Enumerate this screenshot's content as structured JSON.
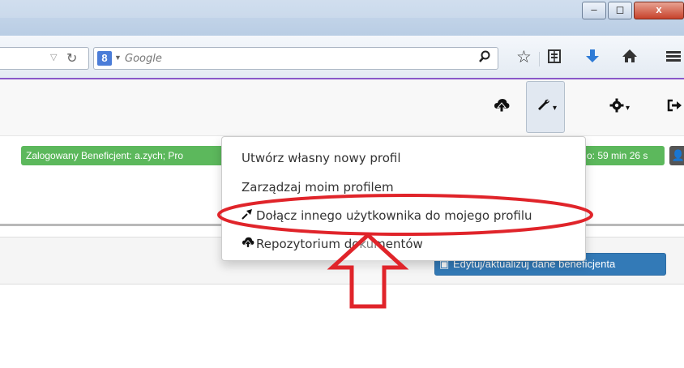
{
  "window": {
    "minimize_glyph": "–",
    "maximize_glyph": "◻",
    "close_glyph": "x"
  },
  "toolbar": {
    "url_dropmark_icon": "dropmarker-icon",
    "reload_icon": "reload-icon",
    "search_engine_badge": "8",
    "search_placeholder": "Google",
    "icons": [
      "search-icon",
      "star-icon",
      "reader-icon",
      "download-icon",
      "home-icon",
      "menu-icon"
    ]
  },
  "navbar": {
    "icons": [
      "upload-cloud-icon",
      "wrench-icon",
      "gear-icon",
      "sign-out-icon"
    ],
    "active": "wrench-icon"
  },
  "status": {
    "logged_in_text": "Zalogowany Beneficjent: a.zych; Pro",
    "timer_text": "o: 59 min 26 s",
    "color": "#5cb85c"
  },
  "dropdown": {
    "items": [
      {
        "label": "Utwórz własny nowy profil",
        "icon": ""
      },
      {
        "label": "Zarządzaj moim profilem",
        "icon": ""
      },
      {
        "label": "Dołącz innego użytkownika do mojego profilu",
        "icon": "join-icon",
        "highlighted": true
      },
      {
        "label": "Repozytorium dokumentów",
        "icon": "upload-cloud-icon"
      }
    ]
  },
  "panel": {
    "edit_button_label": "Edytuj/aktualizuj dane beneficjenta",
    "button_color": "#337ab7"
  },
  "annotation": {
    "color": "#e0242a",
    "shapes": [
      "ellipse-highlight",
      "up-arrow"
    ]
  }
}
